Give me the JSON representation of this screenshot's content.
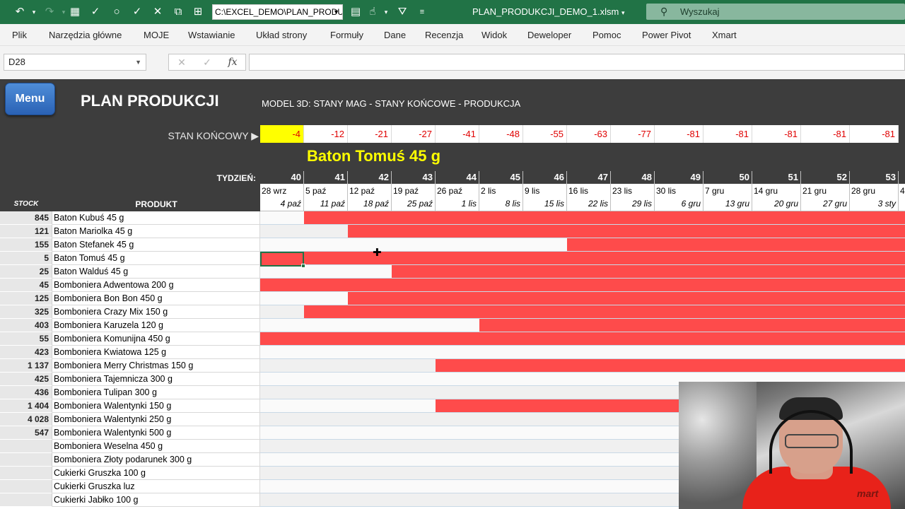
{
  "titlebar": {
    "path": "C:\\EXCEL_DEMO\\PLAN_PRODU",
    "document_title": "PLAN_PRODUKCJI_DEMO_1.xlsm",
    "search_placeholder": "Wyszukaj"
  },
  "ribbon": {
    "tabs": [
      "Plik",
      "Narzędzia główne",
      "MOJE",
      "Wstawianie",
      "Układ strony",
      "Formuły",
      "Dane",
      "Recenzja",
      "Widok",
      "Deweloper",
      "Pomoc",
      "Power Pivot",
      "Xmart"
    ]
  },
  "formula_bar": {
    "name_box": "D28",
    "formula": ""
  },
  "sheet": {
    "menu_button": "Menu",
    "plan_title": "PLAN PRODUKCJI",
    "model_title": "MODEL 3D: STANY MAG - STANY KOŃCOWE - PRODUKCJA",
    "stan_label": "STAN KOŃCOWY ▶",
    "stan_values": [
      "-4",
      "-12",
      "-21",
      "-27",
      "-41",
      "-48",
      "-55",
      "-63",
      "-77",
      "-81",
      "-81",
      "-81",
      "-81",
      "-81"
    ],
    "product_title": "Baton Tomuś 45 g",
    "tydzien_label": "TYDZIEŃ:",
    "stock_header": "STOCK",
    "produkt_header": "PRODUKT",
    "weeks": [
      {
        "num": "40",
        "start": "28 wrz",
        "end": "4 paź"
      },
      {
        "num": "41",
        "start": "5 paź",
        "end": "11 paź"
      },
      {
        "num": "42",
        "start": "12 paź",
        "end": "18 paź"
      },
      {
        "num": "43",
        "start": "19 paź",
        "end": "25 paź"
      },
      {
        "num": "44",
        "start": "26 paź",
        "end": "1 lis"
      },
      {
        "num": "45",
        "start": "2 lis",
        "end": "8 lis"
      },
      {
        "num": "46",
        "start": "9 lis",
        "end": "15 lis"
      },
      {
        "num": "47",
        "start": "16 lis",
        "end": "22 lis"
      },
      {
        "num": "48",
        "start": "23 lis",
        "end": "29 lis"
      },
      {
        "num": "49",
        "start": "30 lis",
        "end": "6 gru"
      },
      {
        "num": "50",
        "start": "7 gru",
        "end": "13 gru"
      },
      {
        "num": "51",
        "start": "14 gru",
        "end": "20 gru"
      },
      {
        "num": "52",
        "start": "21 gru",
        "end": "27 gru"
      },
      {
        "num": "53",
        "start": "28 gru",
        "end": "3 sty"
      },
      {
        "num": "",
        "start": "4",
        "end": ""
      }
    ],
    "rows": [
      {
        "stock": "845",
        "name": "Baton Kubuś 45 g",
        "shortage_from_week": "41"
      },
      {
        "stock": "121",
        "name": "Baton Mariolka 45 g",
        "shortage_from_week": "42"
      },
      {
        "stock": "155",
        "name": "Baton Stefanek 45 g",
        "shortage_from_week": "47"
      },
      {
        "stock": "5",
        "name": "Baton Tomuś 45 g",
        "shortage_from_week": "40"
      },
      {
        "stock": "25",
        "name": "Baton Walduś 45 g",
        "shortage_from_week": "43"
      },
      {
        "stock": "45",
        "name": "Bomboniera Adwentowa 200 g",
        "shortage_from_week": "40"
      },
      {
        "stock": "125",
        "name": "Bomboniera Bon Bon 450 g",
        "shortage_from_week": "42"
      },
      {
        "stock": "325",
        "name": "Bomboniera Crazy Mix 150 g",
        "shortage_from_week": "41"
      },
      {
        "stock": "403",
        "name": "Bomboniera Karuzela 120 g",
        "shortage_from_week": "45"
      },
      {
        "stock": "55",
        "name": "Bomboniera Komunijna 450 g",
        "shortage_from_week": "40"
      },
      {
        "stock": "423",
        "name": "Bomboniera Kwiatowa 125 g",
        "shortage_from_week": ""
      },
      {
        "stock": "1 137",
        "name": "Bomboniera Merry Christmas 150 g",
        "shortage_from_week": "44"
      },
      {
        "stock": "425",
        "name": "Bomboniera Tajemnicza 300 g",
        "shortage_from_week": ""
      },
      {
        "stock": "436",
        "name": "Bomboniera Tulipan 300 g",
        "shortage_from_week": ""
      },
      {
        "stock": "1 404",
        "name": "Bomboniera Walentynki 150 g",
        "shortage_from_week": "44"
      },
      {
        "stock": "4 028",
        "name": "Bomboniera Walentynki 250 g",
        "shortage_from_week": ""
      },
      {
        "stock": "547",
        "name": "Bomboniera Walentynki 500 g",
        "shortage_from_week": "50"
      },
      {
        "stock": "",
        "name": "Bomboniera Weselna 450 g",
        "shortage_from_week": ""
      },
      {
        "stock": "",
        "name": "Bomboniera Złoty podarunek 300 g",
        "shortage_from_week": ""
      },
      {
        "stock": "",
        "name": "Cukierki Gruszka 100 g",
        "shortage_from_week": ""
      },
      {
        "stock": "",
        "name": "Cukierki Gruszka luz",
        "shortage_from_week": ""
      },
      {
        "stock": "",
        "name": "Cukierki Jabłko 100 g",
        "shortage_from_week": ""
      }
    ],
    "shortage_color": "#fe4b4b",
    "header_color": "#3d3d3d",
    "accent_color": "#217346"
  },
  "webcam": {
    "logo_text": "mart"
  }
}
